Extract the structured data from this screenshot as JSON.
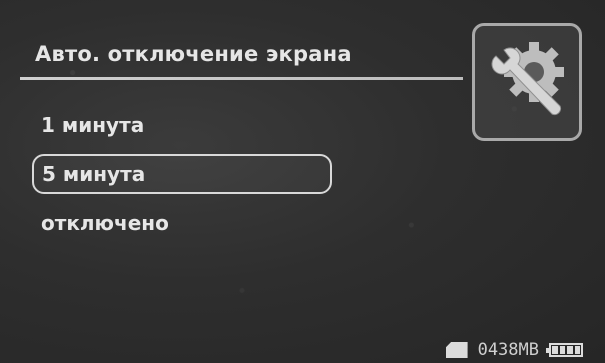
{
  "screen": {
    "title": "Авто. отключение экрана"
  },
  "menu": {
    "items": [
      {
        "label": "1 минута"
      },
      {
        "label": "5 минута"
      },
      {
        "label": "отключено"
      }
    ],
    "selected_index": 1
  },
  "settings_icon": "settings-gear-wrench-icon",
  "status_bar": {
    "storage_text": "0438MB",
    "sd_icon": "sd-card-icon",
    "battery_icon": "battery-icon",
    "battery_level": 1.0
  }
}
